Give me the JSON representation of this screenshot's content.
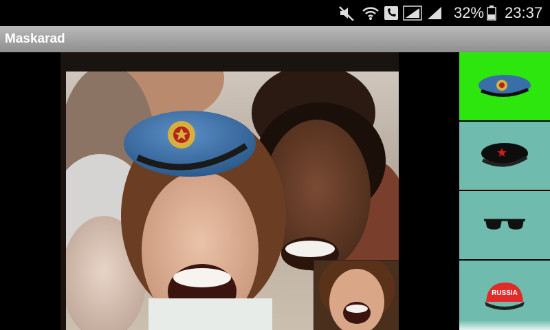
{
  "status_bar": {
    "battery_percent": "32%",
    "time": "23:37"
  },
  "app": {
    "title": "Maskarad"
  },
  "accessories": [
    {
      "id": "blue-beret",
      "selected": true
    },
    {
      "id": "black-beret",
      "selected": false
    },
    {
      "id": "sunglasses",
      "selected": false
    },
    {
      "id": "red-cap",
      "selected": false,
      "text": "RUSSIA"
    }
  ],
  "colors": {
    "selected_item": "#2de60e",
    "item_background": "#6fbcae",
    "title_bar": "#a3a3a3"
  }
}
